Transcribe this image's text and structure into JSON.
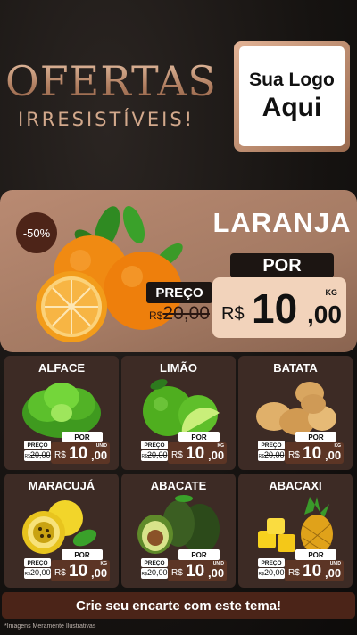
{
  "header": {
    "title": "OFERTAS",
    "subtitle": "IRRESISTÍVEIS!",
    "logo_line1": "Sua Logo",
    "logo_line2": "Aqui"
  },
  "featured": {
    "discount": "-50%",
    "name": "LARANJA",
    "por_label": "POR",
    "preco_label": "PREÇO",
    "old_currency": "R$",
    "old_amount": "20,00",
    "currency": "R$",
    "price_int": "10",
    "price_dec": ",00",
    "unit": "KG",
    "icon": "orange-fruit-icon"
  },
  "products": [
    {
      "name": "ALFACE",
      "unit": "UNID",
      "icon": "lettuce-icon"
    },
    {
      "name": "LIMÃO",
      "unit": "KG",
      "icon": "lime-icon"
    },
    {
      "name": "BATATA",
      "unit": "KG",
      "icon": "potato-icon"
    },
    {
      "name": "MARACUJÁ",
      "unit": "KG",
      "icon": "passion-fruit-icon"
    },
    {
      "name": "ABACATE",
      "unit": "UNID",
      "icon": "avocado-icon"
    },
    {
      "name": "ABACAXI",
      "unit": "UNID",
      "icon": "pineapple-icon"
    }
  ],
  "card_labels": {
    "por": "POR",
    "preco": "PREÇO",
    "old_currency": "R$",
    "old_amount": "20,00",
    "currency": "R$",
    "price_int": "10",
    "price_dec": ",00"
  },
  "cta": "Crie seu encarte com este tema!",
  "disclaimer": "*Imagens Meramente Ilustrativas",
  "colors": {
    "background": "#141110",
    "accent_copper": "#c99a7c",
    "feature_panel": "#b98a72",
    "card_bg": "#3d2b25",
    "price_badge": "#5c3525",
    "cta_bg": "#4b2418"
  }
}
